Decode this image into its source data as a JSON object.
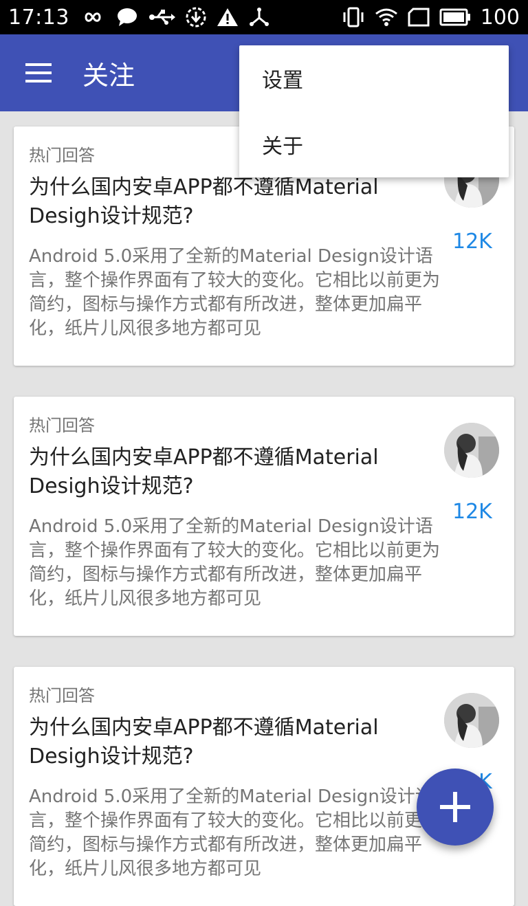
{
  "status_bar": {
    "time": "17:13",
    "battery_level": "100",
    "icons": [
      "infinity-icon",
      "chat-bubble-icon",
      "usb-icon",
      "download-icon",
      "warning-icon",
      "share-node-icon",
      "vibrate-icon",
      "wifi-icon",
      "sim-icon",
      "battery-icon"
    ]
  },
  "app_bar": {
    "title": "关注",
    "menu_icon": "hamburger-menu-icon",
    "background_color": "#3f51b5"
  },
  "menu": {
    "items": [
      {
        "label": "设置"
      },
      {
        "label": "关于"
      }
    ]
  },
  "cards": [
    {
      "category": "热门回答",
      "title": "为什么国内安卓APP都不遵循Material Desigh设计规范?",
      "excerpt": "Android 5.0采用了全新的Material Design设计语言，整个操作界面有了较大的变化。它相比以前更为简约，图标与操作方式都有所改进，整体更加扁平化，纸片儿风很多地方都可见",
      "count": "12K"
    },
    {
      "category": "热门回答",
      "title": "为什么国内安卓APP都不遵循Material Desigh设计规范?",
      "excerpt": "Android 5.0采用了全新的Material Design设计语言，整个操作界面有了较大的变化。它相比以前更为简约，图标与操作方式都有所改进，整体更加扁平化，纸片儿风很多地方都可见",
      "count": "12K"
    },
    {
      "category": "热门回答",
      "title": "为什么国内安卓APP都不遵循Material Desigh设计规范?",
      "excerpt": "Android 5.0采用了全新的Material Design设计语言，整个操作界面有了较大的变化。它相比以前更为简约，图标与操作方式都有所改进，整体更加扁平化，纸片儿风很多地方都可见",
      "count": "12K"
    }
  ],
  "fab": {
    "icon": "plus-icon",
    "color": "#3f51b5"
  },
  "colors": {
    "accent": "#1e88e5",
    "background": "#e3e3e3"
  }
}
